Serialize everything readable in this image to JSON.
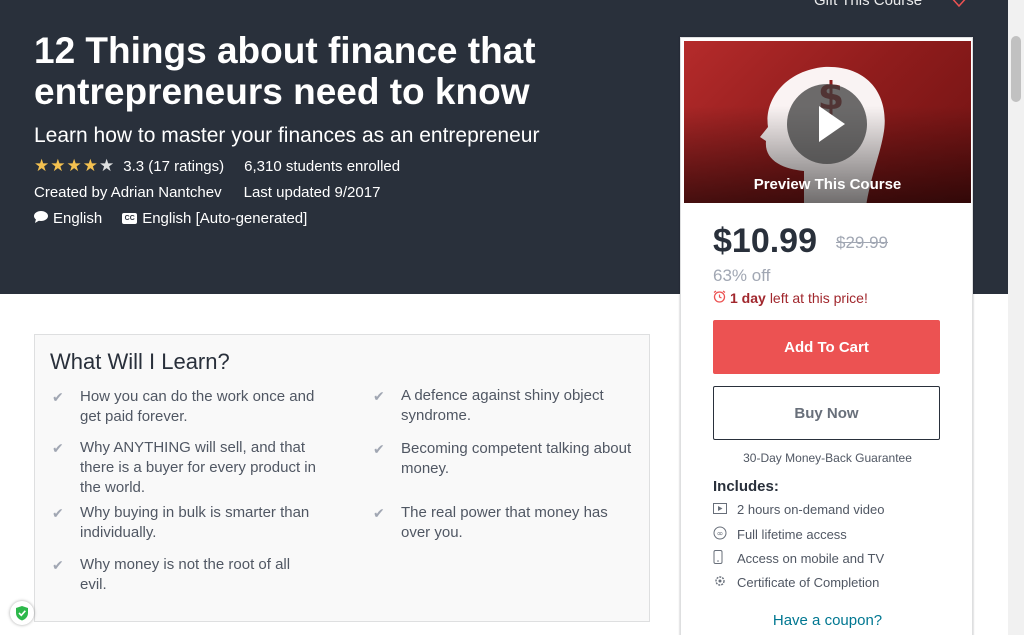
{
  "header": {
    "gift_label": "Gift This Course",
    "title": "12 Things about finance that entrepreneurs need to know",
    "subtitle": "Learn how to master your finances as an entrepreneur",
    "rating": 3.3,
    "rating_text": "3.3 (17 ratings)",
    "students": "6,310 students enrolled",
    "created_by": "Created by Adrian Nantchev",
    "last_updated": "Last updated 9/2017",
    "language": "English",
    "captions": "English [Auto-generated]",
    "bg_color": "#29303b",
    "star_color": "#f4c150"
  },
  "learn": {
    "title": "What Will I Learn?",
    "items": [
      "How you can do the work once and get paid forever.",
      "A defence against shiny object syndrome.",
      "Why ANYTHING will sell, and that there is a buyer for every product in the world.",
      "Becoming competent talking about money.",
      "Why buying in bulk is smarter than individually.",
      "The real power that money has over you.",
      "Why money is not the root of all evil."
    ]
  },
  "sidebar": {
    "preview_label": "Preview This Course",
    "price": "$10.99",
    "original_price": "$29.99",
    "discount": "63% off",
    "timer_bold": "1 day",
    "timer_rest": "left at this price!",
    "add_to_cart": "Add To Cart",
    "buy_now": "Buy Now",
    "guarantee": "30-Day Money-Back Guarantee",
    "includes_title": "Includes:",
    "includes": [
      {
        "icon": "video-icon",
        "label": "2 hours on-demand video"
      },
      {
        "icon": "infinity-icon",
        "label": "Full lifetime access"
      },
      {
        "icon": "mobile-icon",
        "label": "Access on mobile and TV"
      },
      {
        "icon": "certificate-icon",
        "label": "Certificate of Completion"
      }
    ],
    "coupon": "Have a coupon?",
    "accent_color": "#ec5252",
    "link_color": "#007791"
  }
}
